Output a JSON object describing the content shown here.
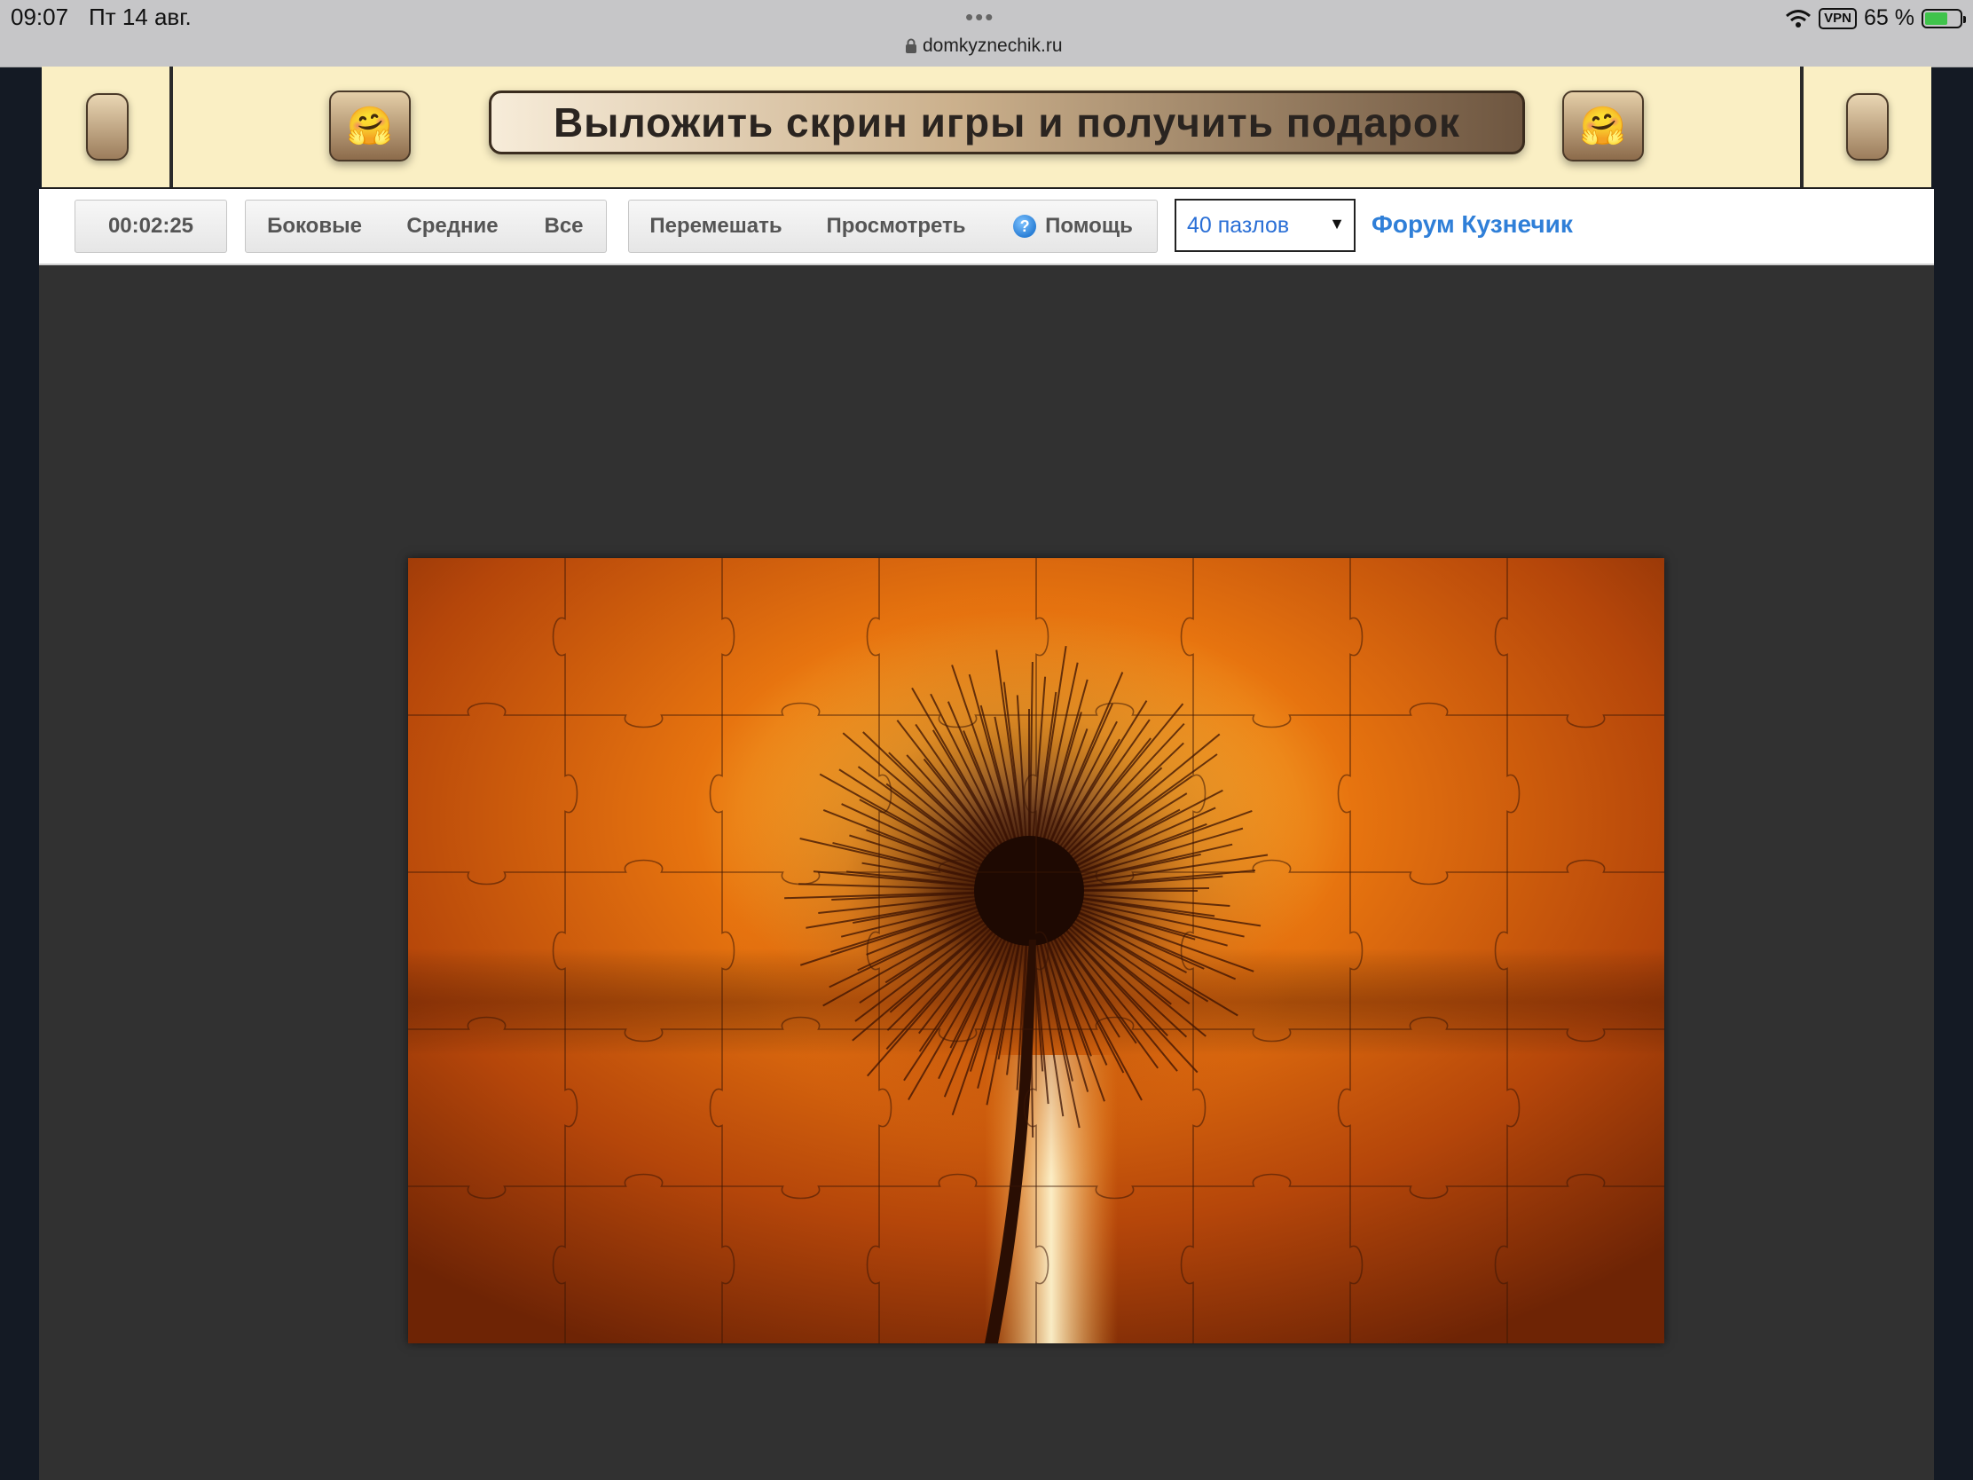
{
  "status_bar": {
    "time": "09:07",
    "date": "Пт 14 авг.",
    "dots": "•••",
    "url": "domkyznechik.ru",
    "vpn": "VPN",
    "battery_text": "65 %",
    "battery_level": 0.65
  },
  "banner": {
    "title": "Выложить скрин игры и получить подарок",
    "emoji_left": "🤗",
    "emoji_right": "🤗"
  },
  "toolbar": {
    "timer": "00:02:25",
    "filter_edges": "Боковые",
    "filter_middle": "Средние",
    "filter_all": "Все",
    "shuffle": "Перемешать",
    "preview": "Просмотреть",
    "help": "Помощь",
    "pieces_select": "40 пазлов",
    "forum_link": "Форум Кузнечик"
  },
  "puzzle": {
    "columns": 8,
    "rows": 5,
    "image_subject": "dandelion-sunset"
  },
  "colors": {
    "banner_bg": "#faefc4",
    "play_area_bg": "#313131",
    "link_blue": "#2f7fd8"
  }
}
